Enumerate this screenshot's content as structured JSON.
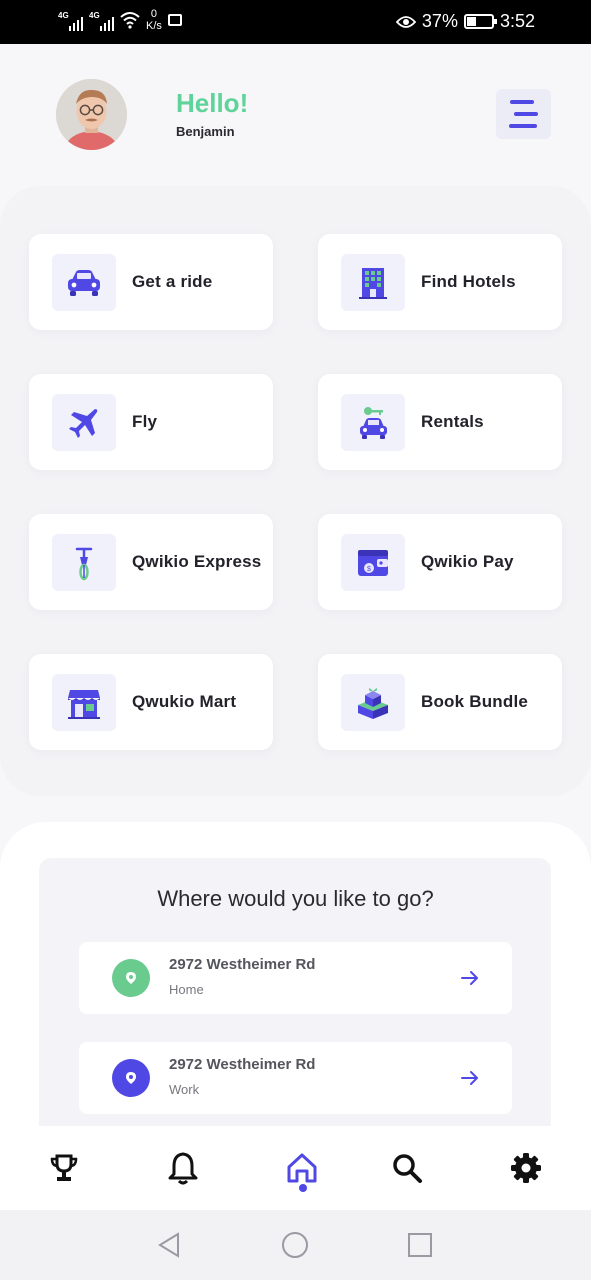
{
  "status_bar": {
    "network_1": "4G",
    "network_2": "4G",
    "speed_value": "0",
    "speed_unit": "K/s",
    "battery": "37%",
    "time": "3:52"
  },
  "header": {
    "greeting": "Hello!",
    "user_name": "Benjamin"
  },
  "services": [
    {
      "label": "Get a ride",
      "icon": "car-icon"
    },
    {
      "label": "Find Hotels",
      "icon": "hotel-icon"
    },
    {
      "label": "Fly",
      "icon": "airplane-icon"
    },
    {
      "label": "Rentals",
      "icon": "rental-car-key-icon"
    },
    {
      "label": "Qwikio Express",
      "icon": "bicycle-icon"
    },
    {
      "label": "Qwikio Pay",
      "icon": "wallet-icon"
    },
    {
      "label": "Qwukio Mart",
      "icon": "store-icon"
    },
    {
      "label": "Book Bundle",
      "icon": "gift-box-icon"
    }
  ],
  "destinations": {
    "title": "Where would you like to go?",
    "items": [
      {
        "address": "2972 Westheimer Rd",
        "tag": "Home",
        "pin_color": "#6acb8f"
      },
      {
        "address": "2972 Westheimer Rd",
        "tag": "Work",
        "pin_color": "#5048e5"
      }
    ]
  },
  "bottom_nav": [
    {
      "icon": "trophy-icon"
    },
    {
      "icon": "bell-icon"
    },
    {
      "icon": "home-icon",
      "active": true
    },
    {
      "icon": "search-icon"
    },
    {
      "icon": "settings-icon"
    }
  ],
  "colors": {
    "accent": "#5048e5",
    "greeting": "#5fd39a",
    "home_pin": "#6acb8f",
    "work_pin": "#5048e5"
  }
}
